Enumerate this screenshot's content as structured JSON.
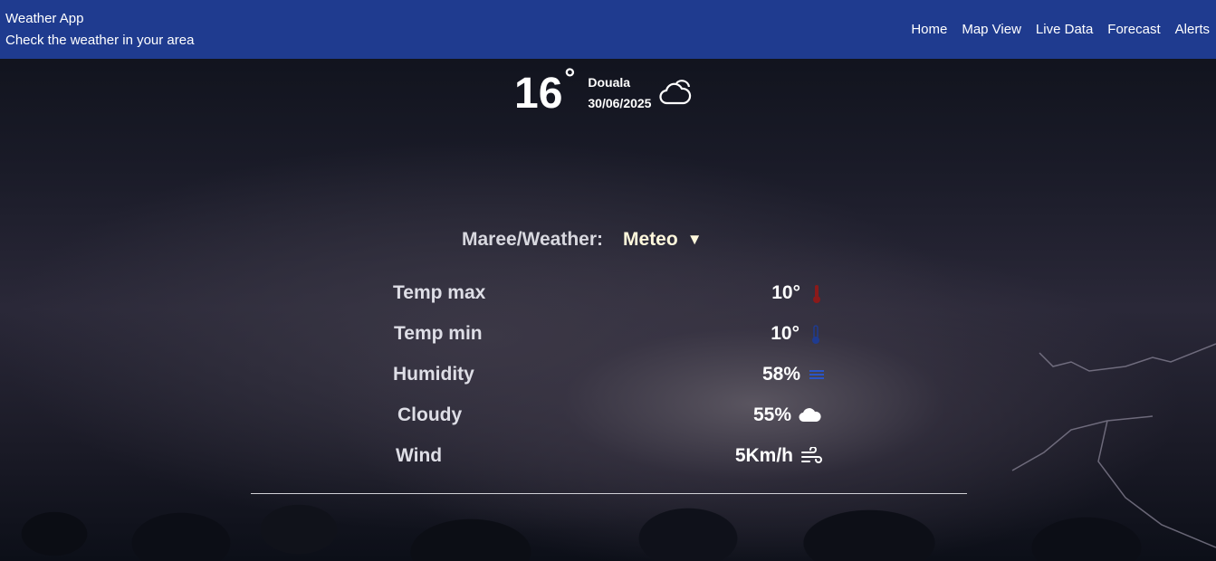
{
  "header": {
    "title": "Weather App",
    "subtitle": "Check the weather in your area",
    "nav": [
      "Home",
      "Map View",
      "Live Data",
      "Forecast",
      "Alerts"
    ]
  },
  "current": {
    "temperature": "16",
    "degree_symbol": "°",
    "city": "Douala",
    "date": "30/06/2025",
    "icon": "cloud-sun-icon"
  },
  "selector": {
    "label": "Maree/Weather:",
    "value": "Meteo",
    "caret": "▼"
  },
  "metrics": [
    {
      "label": "Temp max",
      "value": "10°",
      "icon": "thermometer-high-icon",
      "color": "#8b1a1a"
    },
    {
      "label": "Temp min",
      "value": "10°",
      "icon": "thermometer-low-icon",
      "color": "#1f3b8f"
    },
    {
      "label": "Humidity",
      "value": "58%",
      "icon": "humidity-lines-icon",
      "color": "#2a55c8"
    },
    {
      "label": "Cloudy",
      "value": "55%",
      "icon": "cloud-icon",
      "color": "#ffffff"
    },
    {
      "label": "Wind",
      "value": "5Km/h",
      "icon": "wind-icon",
      "color": "#ffffff"
    }
  ],
  "colors": {
    "header_bg": "#1f3b8f",
    "accent": "#fff8dc"
  }
}
